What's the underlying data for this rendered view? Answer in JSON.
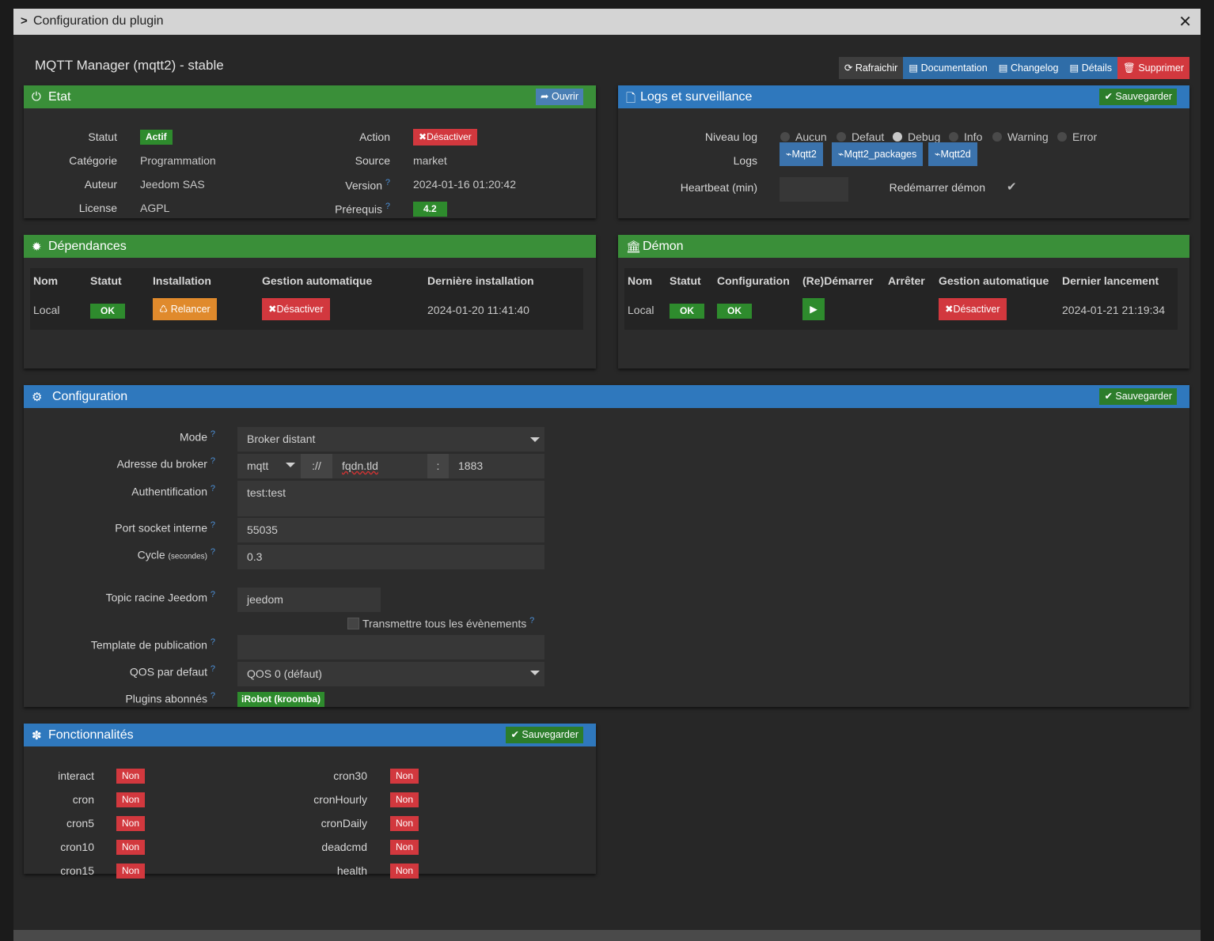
{
  "modal": {
    "title": "Configuration du plugin",
    "close": "✕"
  },
  "plugin": {
    "name": "MQTT Manager (mqtt2) - stable"
  },
  "toolbar": {
    "refresh": "Rafraichir",
    "documentation": "Documentation",
    "changelog": "Changelog",
    "details": "Détails",
    "delete": "Supprimer"
  },
  "etat": {
    "title": "Etat",
    "open": "Ouvrir",
    "statut_label": "Statut",
    "statut_value": "Actif",
    "categorie_label": "Catégorie",
    "categorie_value": "Programmation",
    "auteur_label": "Auteur",
    "auteur_value": "Jeedom SAS",
    "license_label": "License",
    "license_value": "AGPL",
    "action_label": "Action",
    "action_value": "Désactiver",
    "source_label": "Source",
    "source_value": "market",
    "version_label": "Version",
    "version_value": "2024-01-16 01:20:42",
    "prerequis_label": "Prérequis",
    "prerequis_value": "4.2"
  },
  "logs": {
    "title": "Logs et surveillance",
    "save": "Sauvegarder",
    "niveau_label": "Niveau log",
    "levels": [
      "Aucun",
      "Defaut",
      "Debug",
      "Info",
      "Warning",
      "Error"
    ],
    "selected_level": "Debug",
    "logs_label": "Logs",
    "log_buttons": [
      "Mqtt2",
      "Mqtt2_packages",
      "Mqtt2d"
    ],
    "heartbeat_label": "Heartbeat (min)",
    "heartbeat_value": "",
    "restart_label": "Redémarrer démon",
    "restart_checked": true
  },
  "dependances": {
    "title": "Dépendances",
    "headers": [
      "Nom",
      "Statut",
      "Installation",
      "Gestion automatique",
      "Dernière installation"
    ],
    "row": {
      "nom": "Local",
      "statut": "OK",
      "installation": "Relancer",
      "gestion": "Désactiver",
      "derniere": "2024-01-20 11:41:40"
    }
  },
  "demon": {
    "title": "Démon",
    "headers": [
      "Nom",
      "Statut",
      "Configuration",
      "(Re)Démarrer",
      "Arrêter",
      "Gestion automatique",
      "Dernier lancement"
    ],
    "row": {
      "nom": "Local",
      "statut": "OK",
      "configuration": "OK",
      "gestion": "Désactiver",
      "dernier": "2024-01-21 21:19:34"
    }
  },
  "configuration": {
    "title": "Configuration",
    "save": "Sauvegarder",
    "mode_label": "Mode",
    "mode_value": "Broker distant",
    "broker_label": "Adresse du broker",
    "broker_proto": "mqtt",
    "broker_sep": "://",
    "broker_host": "fqdn.tld",
    "broker_colon": ":",
    "broker_port": "1883",
    "auth_label": "Authentification",
    "auth_value": "test:test",
    "port_label": "Port socket interne",
    "port_value": "55035",
    "cycle_label": "Cycle",
    "cycle_unit": "(secondes)",
    "cycle_value": "0.3",
    "topic_label": "Topic racine Jeedom",
    "topic_value": "jeedom",
    "transmit_label": "Transmettre tous les évènements",
    "template_label": "Template de publication",
    "template_value": "",
    "qos_label": "QOS par defaut",
    "qos_value": "QOS 0 (défaut)",
    "plugins_label": "Plugins abonnés",
    "plugins_value": "iRobot (kroomba)"
  },
  "fonctionnalites": {
    "title": "Fonctionnalités",
    "save": "Sauvegarder",
    "left": [
      {
        "name": "interact",
        "value": "Non"
      },
      {
        "name": "cron",
        "value": "Non"
      },
      {
        "name": "cron5",
        "value": "Non"
      },
      {
        "name": "cron10",
        "value": "Non"
      },
      {
        "name": "cron15",
        "value": "Non"
      }
    ],
    "right": [
      {
        "name": "cron30",
        "value": "Non"
      },
      {
        "name": "cronHourly",
        "value": "Non"
      },
      {
        "name": "cronDaily",
        "value": "Non"
      },
      {
        "name": "deadcmd",
        "value": "Non"
      },
      {
        "name": "health",
        "value": "Non"
      }
    ]
  }
}
